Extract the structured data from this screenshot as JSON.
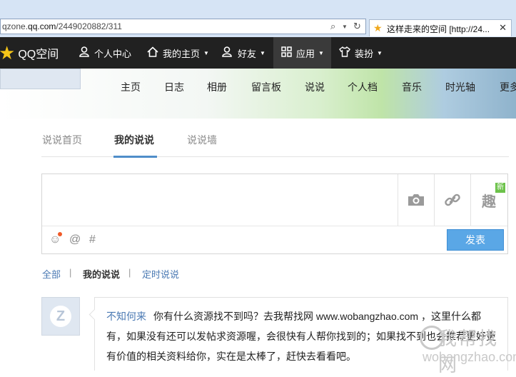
{
  "browser": {
    "url_prefix": "qzone.",
    "url_host": "qq.com",
    "url_path": "/2449020882/311",
    "tab_title": "这样走来的空间 [http://24...",
    "tab_close": "✕"
  },
  "qq_nav": {
    "logo": "QQ空间",
    "items": [
      {
        "label": "个人中心",
        "icon": "person-icon",
        "dropdown": false
      },
      {
        "label": "我的主页",
        "icon": "home-icon",
        "dropdown": true
      },
      {
        "label": "好友",
        "icon": "friends-icon",
        "dropdown": true
      },
      {
        "label": "应用",
        "icon": "grid-icon",
        "dropdown": true
      },
      {
        "label": "装扮",
        "icon": "shirt-icon",
        "dropdown": true
      }
    ]
  },
  "banner_nav": [
    "主页",
    "日志",
    "相册",
    "留言板",
    "说说",
    "个人档",
    "音乐",
    "时光轴",
    "更多"
  ],
  "sub_tabs": [
    "说说首页",
    "我的说说",
    "说说墙"
  ],
  "editor": {
    "tool_new_badge": "新",
    "tool_fun_label": "趣",
    "publish_label": "发表"
  },
  "filters": [
    "全部",
    "我的说说",
    "定时说说"
  ],
  "filter_separator": "|",
  "post": {
    "author": "不知何来",
    "text": "你有什么资源找不到吗？去我帮找网 www.wobangzhao.com ，这里什么都有，如果没有还可以发帖求资源喔，会很快有人帮你找到的；如果找不到也会推荐更好更有价值的相关资料给你，实在是太棒了，赶快去看看吧。"
  },
  "watermark": {
    "title": "我帮找网",
    "site": "wobangzhao.com"
  },
  "colors": {
    "nav_bg": "#212121",
    "accent": "#5aa7e6",
    "link": "#4a79b3"
  }
}
